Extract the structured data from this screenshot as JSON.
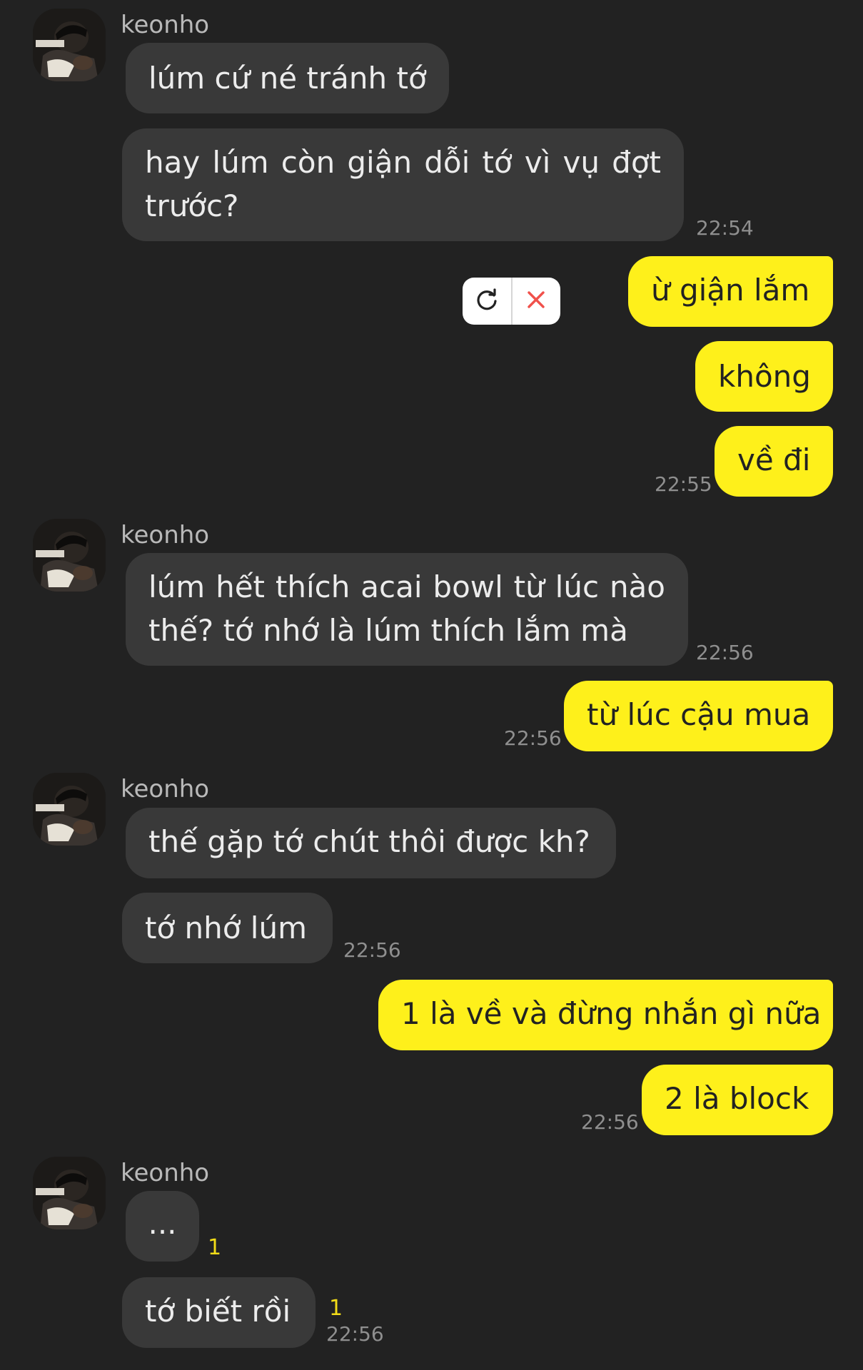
{
  "contact": {
    "name": "keonho"
  },
  "messages": [
    {
      "text": "lúm cứ né tránh tớ"
    },
    {
      "lines": [
        "hay lúm còn giận dỗi tớ vì vụ đợt",
        "trước?"
      ],
      "time": "22:54"
    },
    {
      "text": "ừ giận lắm"
    },
    {
      "text": "không"
    },
    {
      "text": "về đi",
      "time": "22:55"
    },
    {
      "lines": [
        "lúm hết thích acai bowl từ lúc nào",
        "thế? tớ nhớ là lúm thích lắm mà"
      ],
      "time": "22:56"
    },
    {
      "text": "từ lúc cậu mua",
      "time": "22:56"
    },
    {
      "text": "thế gặp tớ chút thôi được kh?"
    },
    {
      "text": "tớ nhớ lúm",
      "time": "22:56"
    },
    {
      "text": "1 là về và đừng nhắn gì nữa"
    },
    {
      "text": "2 là block",
      "time": "22:56"
    },
    {
      "text": "...",
      "unread": "1"
    },
    {
      "text": "tớ biết rồi",
      "unread": "1",
      "time": "22:56"
    }
  ],
  "colors": {
    "background": "#222222",
    "incoming_bubble": "#393939",
    "outgoing_bubble": "#fef01b",
    "unread_count": "#f2dc18"
  },
  "icons": {
    "retry": "refresh-icon",
    "delete": "close-icon"
  }
}
